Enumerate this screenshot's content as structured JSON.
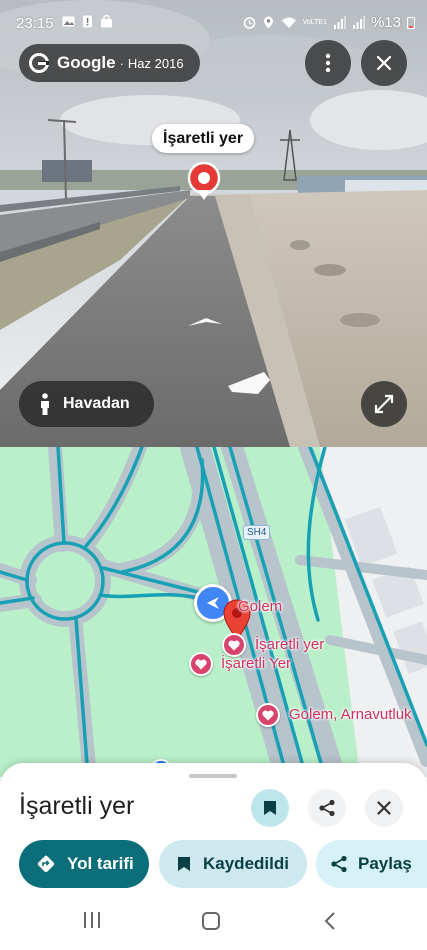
{
  "status_bar": {
    "time": "23:15",
    "network_label": "VoLTE1",
    "battery": "%13"
  },
  "street_view": {
    "brand": "Google",
    "capture_date": "Haz 2016",
    "marker_label": "İşaretli yer",
    "aerial_button": "Havadan",
    "icons": [
      "more-vert-icon",
      "close-icon",
      "fullscreen-icon",
      "person-icon",
      "pin-icon"
    ]
  },
  "map": {
    "road_shield": "SH4",
    "labels": {
      "golem": "Golem",
      "saved_marker": "İşaretli yer",
      "saved_marker2": "İşaretli Yer",
      "golem_city": "Golem, Arnavutluk"
    },
    "colors": {
      "park": "#b9f0c9",
      "road": "#b8c4cc",
      "route": "#18a1b5",
      "pin": "#e53935",
      "heart": "#d8446d"
    }
  },
  "sheet": {
    "title": "İşaretli yer",
    "directions_label": "Yol tarifi",
    "saved_label": "Kaydedildi",
    "share_label": "Paylaş"
  },
  "colors": {
    "primary_teal": "#0b6e78",
    "chip_light": "#cde8ef",
    "chip_lighter": "#d6f1f7"
  }
}
